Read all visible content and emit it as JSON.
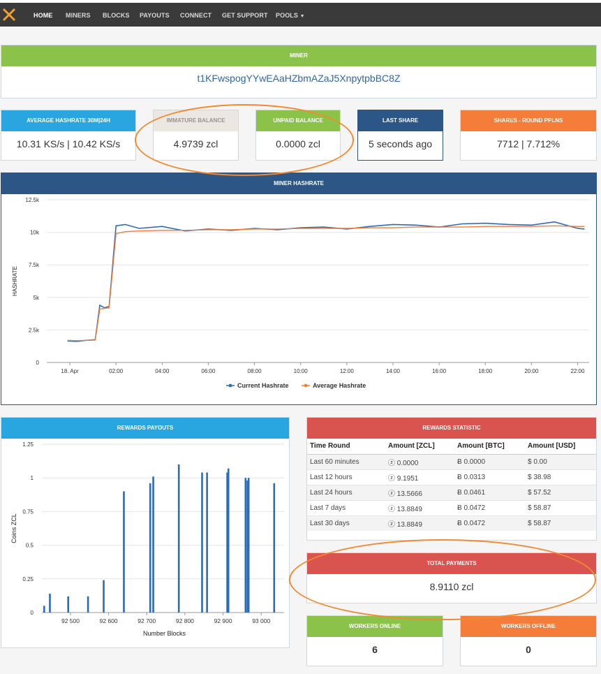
{
  "nav": {
    "items": [
      "HOME",
      "MINERS",
      "BLOCKS",
      "PAYOUTS",
      "CONNECT",
      "GET SUPPORT",
      "POOLS"
    ],
    "active": "HOME"
  },
  "miner": {
    "header": "MINER",
    "address": "t1KFwspogYYwEAaHZbmAZaJ5XnpytpbBC8Z"
  },
  "stats": {
    "avg_hashrate": {
      "label": "AVERAGE HASHRATE 30M|24H",
      "value": "10.31 KS/s | 10.42 KS/s"
    },
    "immature": {
      "label": "IMMATURE BALANCE",
      "value": "4.9739 zcl"
    },
    "unpaid": {
      "label": "UNPAID BALANCE",
      "value": "0.0000 zcl"
    },
    "last_share": {
      "label": "LAST SHARE",
      "value": "5 seconds ago"
    },
    "shares": {
      "label": "SHARES - ROUND PPLNS",
      "value": "7712 | 7.712%"
    }
  },
  "hashrate_panel": {
    "header": "MINER HASHRATE"
  },
  "rewards_payouts_panel": {
    "header": "REWARDS PAYOUTS"
  },
  "rewards_statistic": {
    "header": "REWARDS STATISTIC",
    "columns": [
      "Time Round",
      "Amount [ZCL]",
      "Amount [BTC]",
      "Amount [USD]"
    ],
    "rows": [
      [
        "Last 60 minutes",
        "ⓩ 0.0000",
        "Ƀ 0.0000",
        "$ 0.00"
      ],
      [
        "Last 12 hours",
        "ⓩ 9.1951",
        "Ƀ 0.0313",
        "$ 38.98"
      ],
      [
        "Last 24 hours",
        "ⓩ 13.5666",
        "Ƀ 0.0461",
        "$ 57.52"
      ],
      [
        "Last 7 days",
        "ⓩ 13.8849",
        "Ƀ 0.0472",
        "$ 58.87"
      ],
      [
        "Last 30 days",
        "ⓩ 13.8849",
        "Ƀ 0.0472",
        "$ 58.87"
      ]
    ]
  },
  "total_payments": {
    "label": "TOTAL PAYMENTS",
    "value": "8.9110 zcl"
  },
  "workers_online": {
    "label": "WORKERS ONLINE",
    "value": "6"
  },
  "workers_offline": {
    "label": "WORKERS OFFLINE",
    "value": "0"
  },
  "colors": {
    "current": "#2e6bb5",
    "average": "#f07d3a",
    "bar": "#2e6bb5",
    "annotation": "#f08a33"
  },
  "chart_data": [
    {
      "type": "line",
      "title": "",
      "xlabel": "",
      "ylabel": "HASHRATE",
      "x_ticks": [
        "18. Apr",
        "02:00",
        "04:00",
        "06:00",
        "08:00",
        "10:00",
        "12:00",
        "14:00",
        "16:00",
        "18:00",
        "20:00",
        "22:00"
      ],
      "y_ticks": [
        "0",
        "2.5k",
        "5k",
        "7.5k",
        "10k",
        "12.5k"
      ],
      "x_hours": [
        -0.1,
        0.3,
        0.7,
        1.1,
        1.3,
        1.5,
        1.7,
        2.0,
        2.4,
        3.0,
        4.0,
        5.0,
        6.0,
        7.0,
        8.0,
        9.0,
        10.0,
        11.0,
        12.0,
        13.0,
        14.0,
        15.0,
        16.0,
        17.0,
        18.0,
        19.0,
        20.0,
        21.0,
        22.0,
        22.3
      ],
      "ylim": [
        0,
        12500
      ],
      "legend_position": "bottom",
      "series": [
        {
          "name": "Current Hashrate",
          "values": [
            1650,
            1620,
            1700,
            1750,
            4400,
            4200,
            4300,
            10500,
            10600,
            10300,
            10450,
            10100,
            10250,
            10150,
            10300,
            10200,
            10350,
            10400,
            10250,
            10450,
            10600,
            10550,
            10400,
            10650,
            10700,
            10600,
            10550,
            10800,
            10300,
            10250
          ]
        },
        {
          "name": "Average Hashrate",
          "values": [
            1700,
            1680,
            1700,
            1720,
            4100,
            4150,
            4200,
            9900,
            10050,
            10100,
            10150,
            10150,
            10200,
            10200,
            10250,
            10250,
            10300,
            10300,
            10300,
            10350,
            10350,
            10400,
            10400,
            10400,
            10450,
            10450,
            10450,
            10500,
            10450,
            10450
          ]
        }
      ]
    },
    {
      "type": "bar",
      "title": "",
      "xlabel": "Number Blocks",
      "ylabel": "Coins ZCL",
      "x_ticks": [
        "92 500",
        "92 600",
        "92 700",
        "92 800",
        "92 900",
        "93 000"
      ],
      "y_ticks": [
        "0",
        "0.25",
        "0.5",
        "0.75",
        "1",
        "1.25"
      ],
      "xlim": [
        92425,
        93060
      ],
      "ylim": [
        0,
        1.25
      ],
      "x": [
        92431,
        92446,
        92494,
        92546,
        92587,
        92640,
        92709,
        92717,
        92784,
        92845,
        92858,
        92911,
        92914,
        92959,
        92964,
        92967,
        93034
      ],
      "values": [
        0.05,
        0.14,
        0.12,
        0.12,
        0.24,
        0.9,
        0.96,
        1.01,
        1.1,
        1.04,
        1.04,
        1.04,
        1.07,
        1.0,
        0.98,
        1.0,
        0.96
      ]
    }
  ]
}
